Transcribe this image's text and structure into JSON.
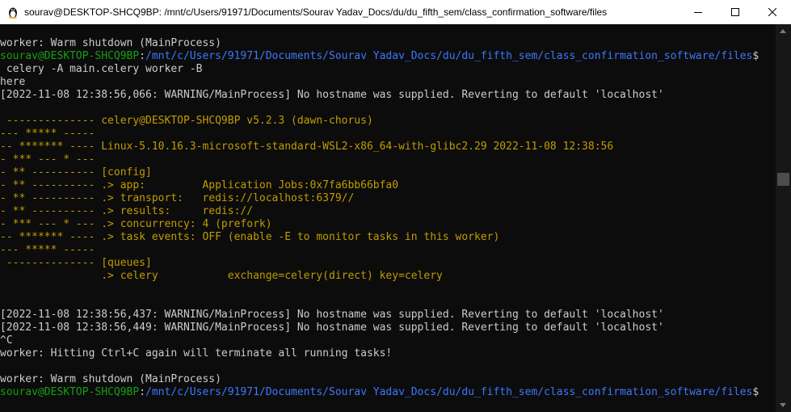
{
  "window": {
    "title": "sourav@DESKTOP-SHCQ9BP: /mnt/c/Users/91971/Documents/Sourav Yadav_Docs/du/du_fifth_sem/class_confirmation_software/files"
  },
  "prompt": {
    "user_host": "sourav@DESKTOP-SHCQ9BP",
    "path": "/mnt/c/Users/91971/Documents/Sourav Yadav_Docs/du/du_fifth_sem/class_confirmation_software/files",
    "symbol": "$"
  },
  "terminal": {
    "l1": "worker: Warm shutdown (MainProcess)",
    "cmd": " celery -A main.celery worker -B",
    "l4": "here",
    "l5": "[2022-11-08 12:38:56,066: WARNING/MainProcess] No hostname was supplied. Reverting to default 'localhost'",
    "b1": " -------------- celery@DESKTOP-SHCQ9BP v5.2.3 (dawn-chorus)",
    "b2": "--- ***** -----",
    "b3": "-- ******* ---- Linux-5.10.16.3-microsoft-standard-WSL2-x86_64-with-glibc2.29 2022-11-08 12:38:56",
    "b4": "- *** --- * ---",
    "b5": "- ** ---------- [config]",
    "b6": "- ** ---------- .> app:         Application Jobs:0x7fa6bb66bfa0",
    "b7": "- ** ---------- .> transport:   redis://localhost:6379//",
    "b8": "- ** ---------- .> results:     redis://",
    "b9": "- *** --- * --- .> concurrency: 4 (prefork)",
    "b10": "-- ******* ---- .> task events: OFF (enable -E to monitor tasks in this worker)",
    "b11": "--- ***** -----",
    "b12": " -------------- [queues]",
    "b13": "                .> celery           exchange=celery(direct) key=celery",
    "w2": "[2022-11-08 12:38:56,437: WARNING/MainProcess] No hostname was supplied. Reverting to default 'localhost'",
    "w3": "[2022-11-08 12:38:56,449: WARNING/MainProcess] No hostname was supplied. Reverting to default 'localhost'",
    "ctrl": "^C",
    "hit": "worker: Hitting Ctrl+C again will terminate all running tasks!",
    "warm2": "worker: Warm shutdown (MainProcess)"
  },
  "colors": {
    "background": "#0c0c0c",
    "text": "#cccccc",
    "prompt_user": "#13a10e",
    "prompt_path": "#3b78ff",
    "celery_banner": "#c19c00"
  },
  "icons": {
    "app": "linux-penguin-icon",
    "minimize": "minimize-icon",
    "maximize": "maximize-icon",
    "close": "close-icon"
  }
}
